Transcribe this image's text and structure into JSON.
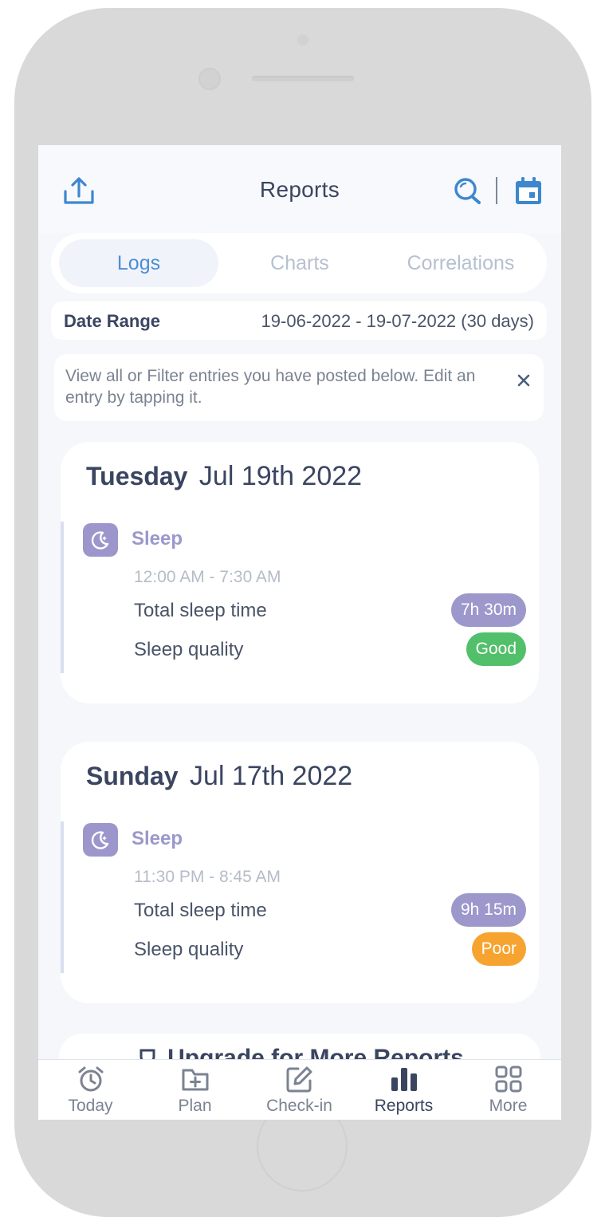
{
  "header": {
    "title": "Reports",
    "icons": [
      "share-icon",
      "search-icon",
      "calendar-icon"
    ],
    "accent_color": "#3d87cf"
  },
  "tabs": [
    {
      "label": "Logs",
      "active": true
    },
    {
      "label": "Charts",
      "active": false
    },
    {
      "label": "Correlations",
      "active": false
    }
  ],
  "date_range": {
    "label": "Date Range",
    "value": "19-06-2022 - 19-07-2022 (30 days)"
  },
  "info_banner": {
    "text": "View all or Filter entries you have posted below. Edit an entry by tapping it.",
    "close_icon": "close-icon"
  },
  "days": [
    {
      "day_name": "Tuesday",
      "date": "Jul 19th 2022",
      "entry": {
        "icon": "sleep-moon-icon",
        "title": "Sleep",
        "time_range": "12:00 AM - 7:30 AM",
        "rows": [
          {
            "label": "Total sleep time",
            "value": "7h 30m"
          },
          {
            "label": "Sleep quality",
            "value": "Good",
            "color": "#52bf6a"
          }
        ]
      }
    },
    {
      "day_name": "Sunday",
      "date": "Jul 17th 2022",
      "entry": {
        "icon": "sleep-moon-icon",
        "title": "Sleep",
        "time_range": "11:30 PM - 8:45 AM",
        "rows": [
          {
            "label": "Total sleep time",
            "value": "9h 15m"
          },
          {
            "label": "Sleep quality",
            "value": "Poor",
            "color": "#f7a330"
          }
        ]
      }
    }
  ],
  "upgrade": {
    "text": "Upgrade for More Reports",
    "icon": "trophy-icon"
  },
  "bottom_nav": [
    {
      "label": "Today",
      "icon": "alarm-clock-icon",
      "active": false
    },
    {
      "label": "Plan",
      "icon": "folder-plus-icon",
      "active": false
    },
    {
      "label": "Check-in",
      "icon": "edit-icon",
      "active": false
    },
    {
      "label": "Reports",
      "icon": "bar-chart-icon",
      "active": true
    },
    {
      "label": "More",
      "icon": "grid-icon",
      "active": false
    }
  ]
}
